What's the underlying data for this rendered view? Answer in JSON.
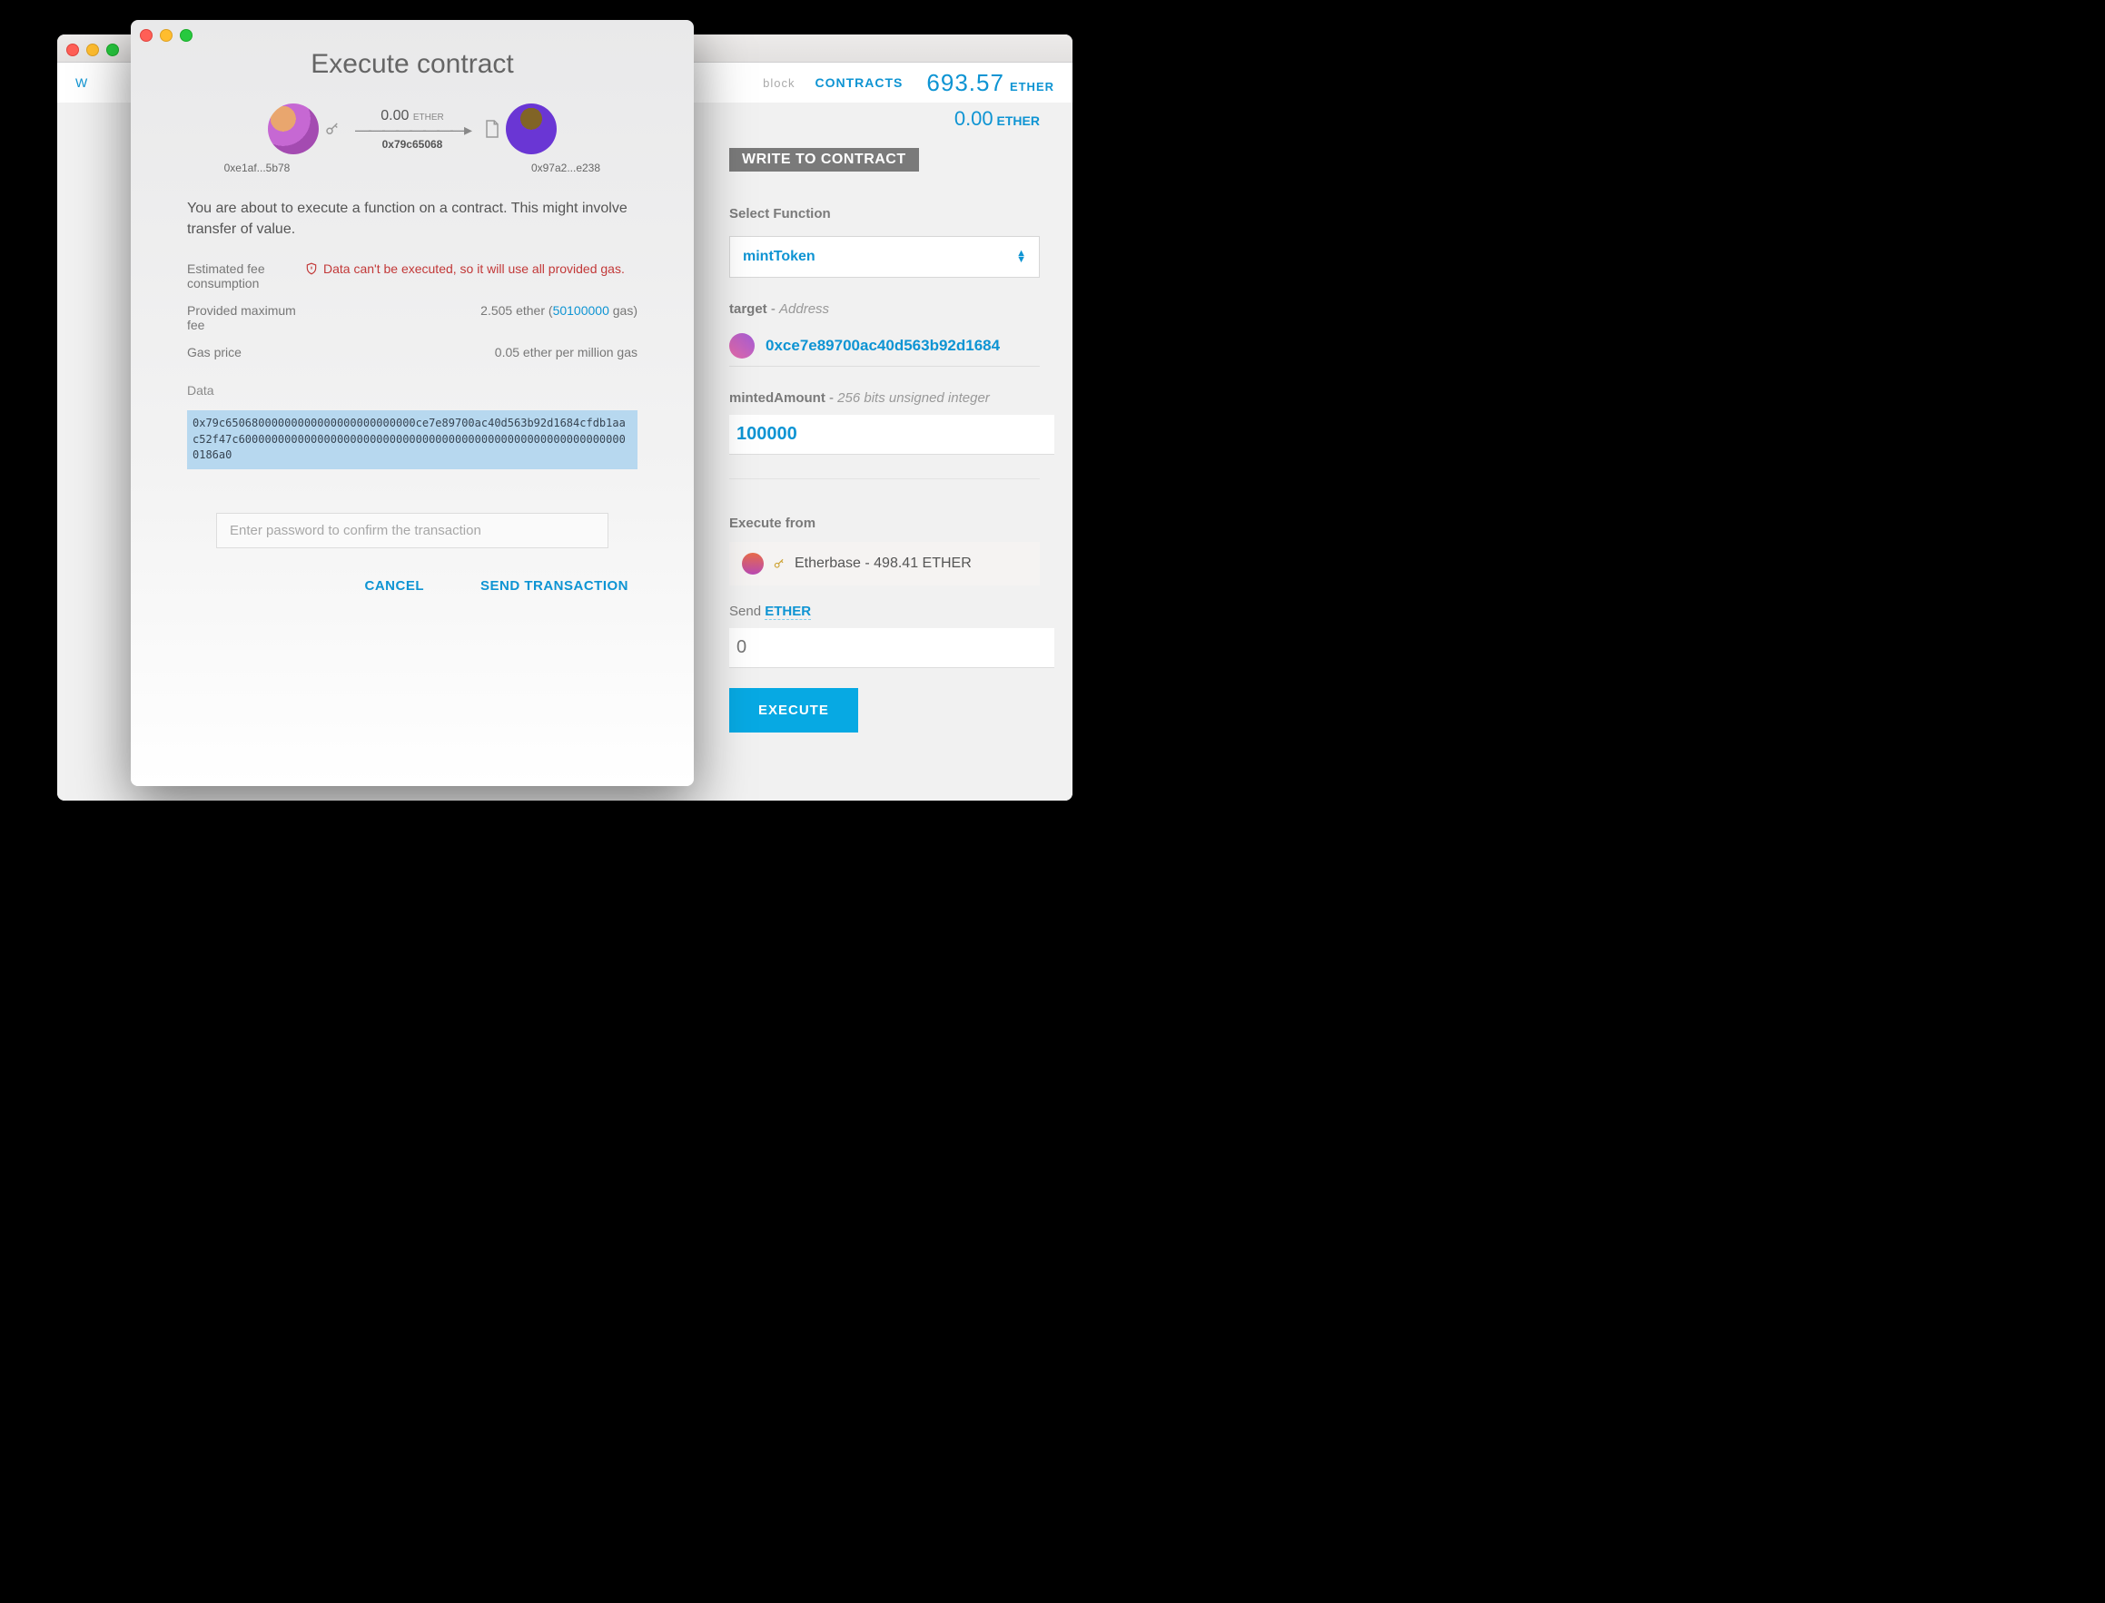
{
  "nav": {
    "w": "W",
    "block_suffix": "block",
    "contracts": "CONTRACTS",
    "balance": "693.57",
    "balance_unit": "ETHER"
  },
  "sub_balance": {
    "amount": "0.00",
    "unit": "ETHER"
  },
  "write_header": "WRITE TO CONTRACT",
  "select_fn": {
    "label": "Select Function",
    "value": "mintToken"
  },
  "target": {
    "label": "target",
    "type": "Address",
    "value": "0xce7e89700ac40d563b92d1684"
  },
  "minted": {
    "label": "mintedAmount",
    "type": "256 bits unsigned integer",
    "value": "100000"
  },
  "exec_from": {
    "label": "Execute from",
    "account": "Etherbase - 498.41 ETHER"
  },
  "send": {
    "label": "Send",
    "unit": "ETHER",
    "placeholder": "0"
  },
  "execute_btn": "EXECUTE",
  "modal": {
    "title": "Execute contract",
    "from_addr": "0xe1af...5b78",
    "to_addr": "0x97a2...e238",
    "amount": "0.00",
    "amount_unit": "ETHER",
    "fn_hash": "0x79c65068",
    "desc": "You are about to execute a function on a contract. This might involve transfer of value.",
    "fee_label": "Estimated fee consumption",
    "fee_err": "Data can't be executed, so it will use all provided gas.",
    "maxfee_label": "Provided maximum fee",
    "maxfee_eth": "2.505 ether",
    "maxfee_gas": "50100000",
    "maxfee_gas_suffix": " gas)",
    "gasprice_label": "Gas price",
    "gasprice_val": "0.05 ether per million gas",
    "data_label": "Data",
    "data_val": "0x79c65068000000000000000000000000ce7e89700ac40d563b92d1684cfdb1aac52f47c600000000000000000000000000000000000000000000000000000000000186a0",
    "pwd_placeholder": "Enter password to confirm the transaction",
    "cancel": "CANCEL",
    "send": "SEND TRANSACTION"
  }
}
